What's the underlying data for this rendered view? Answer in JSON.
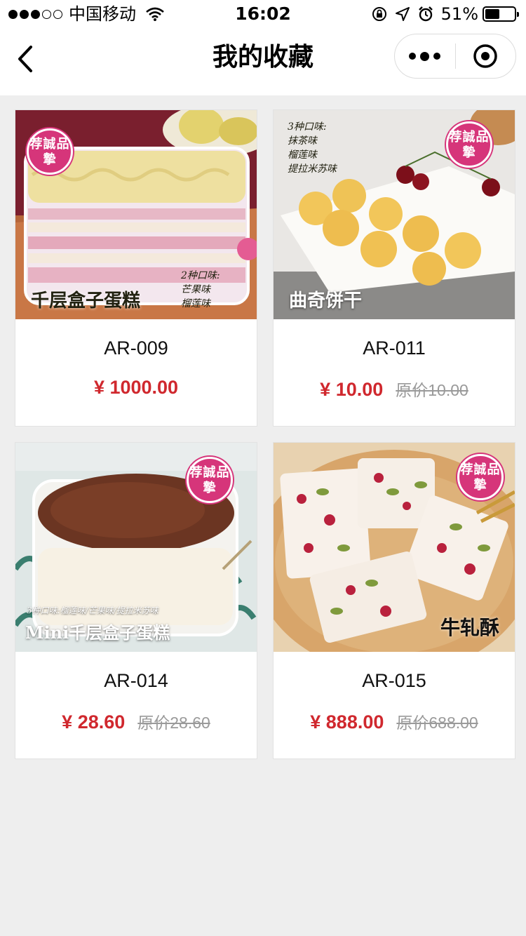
{
  "status_bar": {
    "carrier": "中国移动",
    "time": "16:02",
    "battery": "51%",
    "battery_level": 0.51,
    "signal_bars": 3,
    "signal_total": 5
  },
  "nav": {
    "title": "我的收藏",
    "back_icon": "chevron-left-icon",
    "more_icon": "more-dots-icon",
    "close_icon": "target-circle-icon"
  },
  "colors": {
    "price": "#d0282e",
    "badge": "#d6357a",
    "background": "#eeeeee"
  },
  "products": [
    {
      "code": "AR-009",
      "price": "¥ 1000.00",
      "original_price": "",
      "image": {
        "badge": "荐誠品摯",
        "caption": "千层盒子蛋糕",
        "note": "2种口味:\n芒果味\n榴莲味"
      }
    },
    {
      "code": "AR-011",
      "price": "¥ 10.00",
      "original_price": "原价10.00",
      "image": {
        "badge": "荐誠品摯",
        "caption": "曲奇饼干",
        "note": "3种口味:\n抹茶味\n榴莲味\n提拉米苏味"
      }
    },
    {
      "code": "AR-014",
      "price": "¥ 28.60",
      "original_price": "原价28.60",
      "image": {
        "badge": "荐誠品摯",
        "caption": "Mini千层盒子蛋糕",
        "note": "3种口味:榴莲味/芒果味/提拉米苏味"
      }
    },
    {
      "code": "AR-015",
      "price": "¥ 888.00",
      "original_price": "原价688.00",
      "image": {
        "badge": "荐誠品摯",
        "caption": "牛轧酥",
        "note": ""
      }
    }
  ]
}
